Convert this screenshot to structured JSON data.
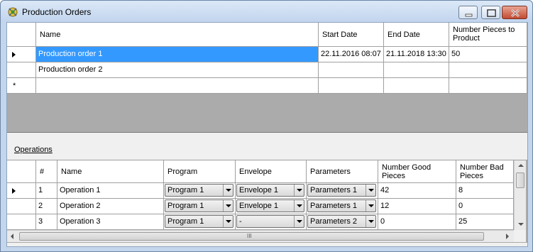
{
  "window": {
    "title": "Production Orders",
    "controls": {
      "minimize": "minimize",
      "maximize": "maximize",
      "close": "close"
    }
  },
  "orders": {
    "headers": [
      "Name",
      "Start Date",
      "End Date",
      "Number Pieces to Product"
    ],
    "rows": [
      {
        "name": "Production order 1",
        "start": "22.11.2016 08:07",
        "end": "21.11.2018 13:30",
        "pieces": "50"
      },
      {
        "name": "Production order 2",
        "start": "",
        "end": "",
        "pieces": ""
      }
    ],
    "new_row_marker": "*"
  },
  "operations": {
    "label": "Operations",
    "headers": [
      "#",
      "Name",
      "Program",
      "Envelope",
      "Parameters",
      "Number Good Pieces",
      "Number Bad Pieces"
    ],
    "rows": [
      {
        "num": "1",
        "name": "Operation 1",
        "program": "Program 1",
        "envelope": "Envelope 1",
        "parameters": "Parameters 1",
        "good": "42",
        "bad": "8"
      },
      {
        "num": "2",
        "name": "Operation 2",
        "program": "Program 1",
        "envelope": "Envelope 1",
        "parameters": "Parameters 1",
        "good": "12",
        "bad": "0"
      },
      {
        "num": "3",
        "name": "Operation 3",
        "program": "Program 1",
        "envelope": "-",
        "parameters": "Parameters 2",
        "good": "0",
        "bad": "25"
      }
    ],
    "hscroll_grip": "III"
  }
}
